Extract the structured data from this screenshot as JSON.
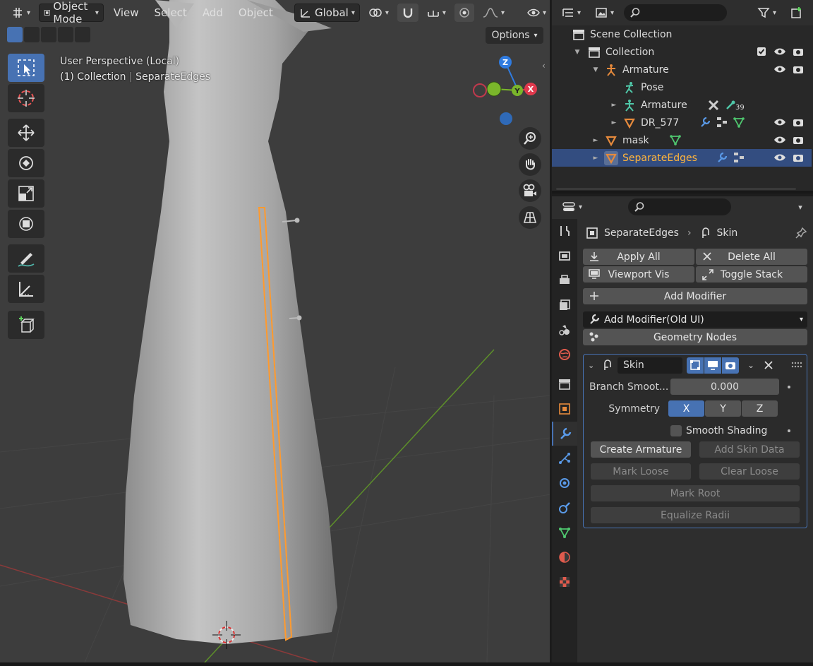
{
  "viewport": {
    "mode": "Object Mode",
    "menus": [
      "View",
      "Select",
      "Add",
      "Object"
    ],
    "orientation": "Global",
    "options_label": "Options",
    "info_line1": "User Perspective (Local)",
    "info_line2_a": "(1) Collection",
    "info_line2_b": "SeparateEdges",
    "gizmo": {
      "z": "Z",
      "y": "Y",
      "x": "X"
    }
  },
  "outliner": {
    "rows": [
      {
        "label": "Scene Collection"
      },
      {
        "label": "Collection"
      },
      {
        "label": "Armature"
      },
      {
        "label": "Pose"
      },
      {
        "label": "Armature",
        "badge": "39"
      },
      {
        "label": "DR_577"
      },
      {
        "label": "mask"
      },
      {
        "label": "SeparateEdges"
      }
    ]
  },
  "properties": {
    "breadcrumb_object": "SeparateEdges",
    "breadcrumb_modifier": "Skin",
    "apply_all": "Apply All",
    "delete_all": "Delete All",
    "viewport_vis": "Viewport Vis",
    "toggle_stack": "Toggle Stack",
    "add_modifier": "Add Modifier",
    "add_modifier_old": "Add Modifier(Old UI)",
    "geometry_nodes": "Geometry Nodes",
    "skin": {
      "name": "Skin",
      "branch_label": "Branch Smoot...",
      "branch_value": "0.000",
      "symmetry_label": "Symmetry",
      "sym_x": "X",
      "sym_y": "Y",
      "sym_z": "Z",
      "smooth_shading": "Smooth Shading",
      "create_armature": "Create Armature",
      "add_skin_data": "Add Skin Data",
      "mark_loose": "Mark Loose",
      "clear_loose": "Clear Loose",
      "mark_root": "Mark Root",
      "equalize_radii": "Equalize Radii"
    }
  },
  "colors": {
    "accent": "#4772b3",
    "selected_text": "#ffb43c",
    "x_axis": "#e0394d",
    "y_axis": "#7ab62b",
    "z_axis": "#2f7be0"
  }
}
